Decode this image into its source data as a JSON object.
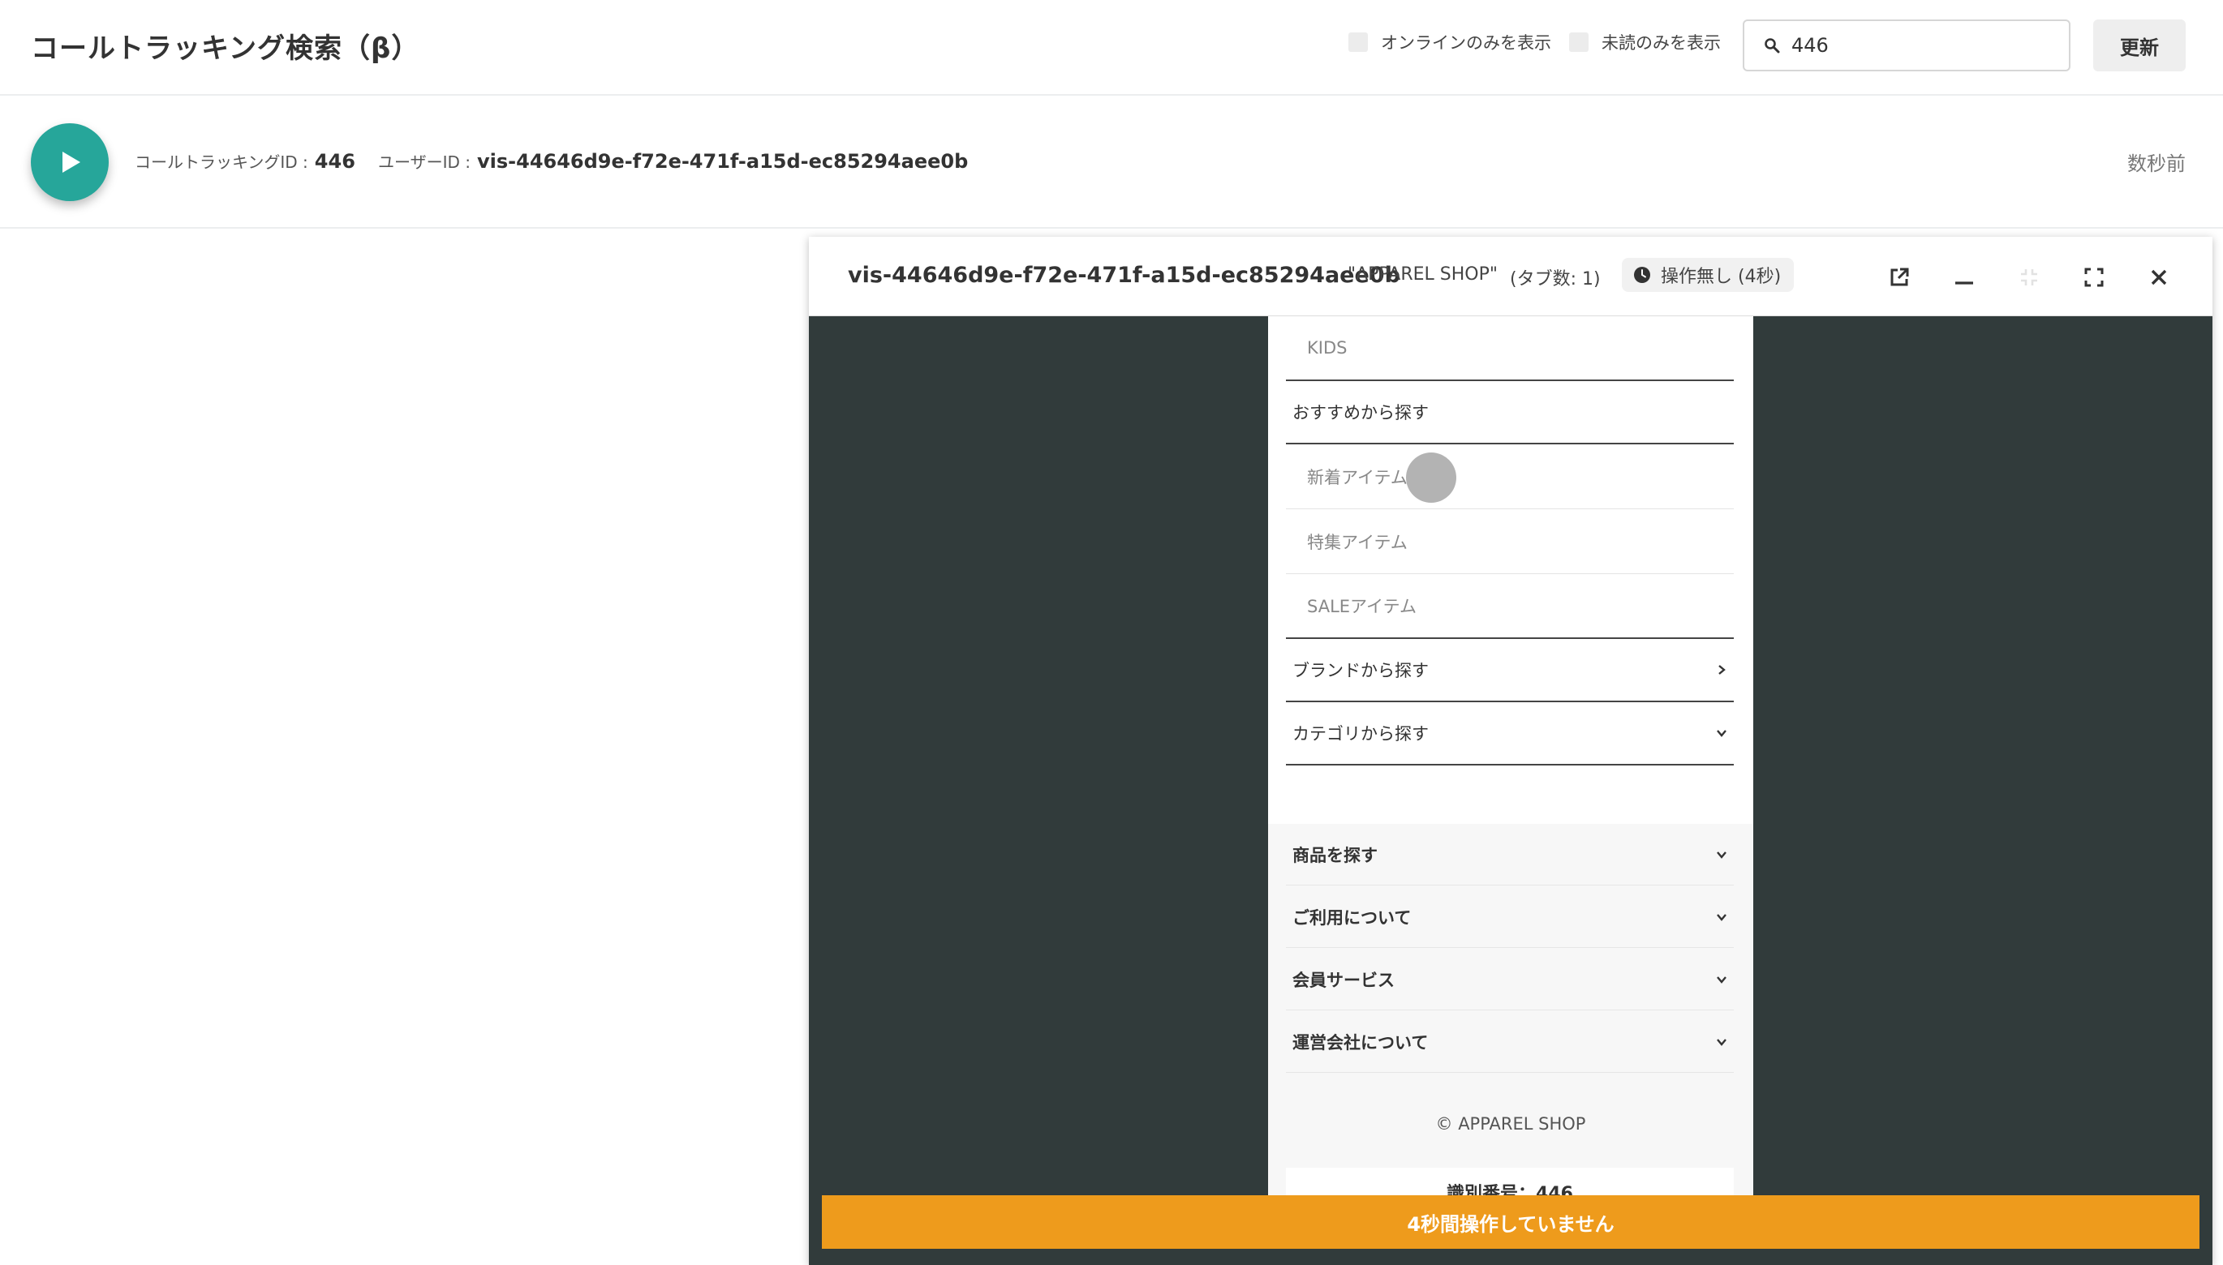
{
  "header": {
    "title": "コールトラッキング検索（β）",
    "filter_online": "オンラインのみを表示",
    "filter_unread": "未読のみを表示",
    "search_value": "446",
    "update_label": "更新"
  },
  "session": {
    "tracking_label": "コールトラッキングID :",
    "tracking_id": "446",
    "user_label": "ユーザーID :",
    "user_id": "vis-44646d9e-f72e-471f-a15d-ec85294aee0b",
    "time_ago": "数秒前"
  },
  "viewer": {
    "visitor_id": "vis-44646d9e-f72e-471f-a15d-ec85294aee0b",
    "site_name": "\"APPAREL SHOP\"",
    "tab_count": "(タブ数: 1)",
    "status": "操作無し (4秒)",
    "idle_message": "4秒間操作していません",
    "screen": {
      "menu": [
        {
          "label": "KIDS"
        },
        {
          "label": "おすすめから探す"
        },
        {
          "label": "新着アイテム"
        },
        {
          "label": "特集アイテム"
        },
        {
          "label": "SALEアイテム"
        },
        {
          "label": "ブランドから探す"
        },
        {
          "label": "カテゴリから探す"
        }
      ],
      "footer": [
        {
          "label": "商品を探す"
        },
        {
          "label": "ご利用について"
        },
        {
          "label": "会員サービス"
        },
        {
          "label": "運営会社について"
        }
      ],
      "copyright": "© APPAREL SHOP",
      "ident": "識別番号：446"
    }
  }
}
